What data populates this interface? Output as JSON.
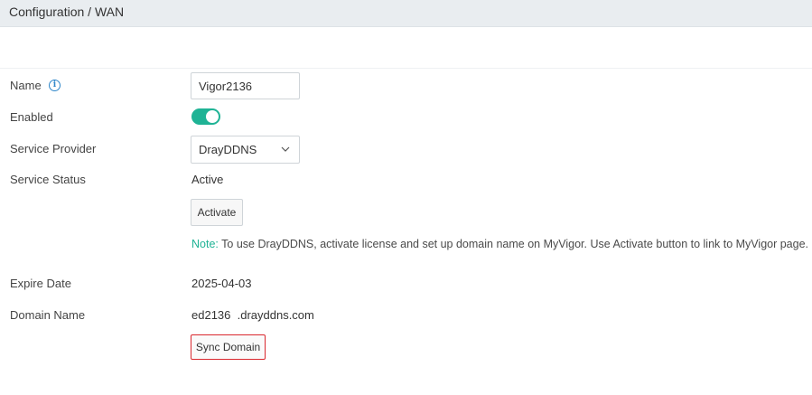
{
  "header": {
    "breadcrumb": "Configuration / WAN"
  },
  "form": {
    "name": {
      "label": "Name",
      "value": "Vigor2136"
    },
    "enabled": {
      "label": "Enabled",
      "on": true
    },
    "service_provider": {
      "label": "Service Provider",
      "selected": "DrayDDNS"
    },
    "service_status": {
      "label": "Service Status",
      "value": "Active",
      "activate_label": "Activate"
    },
    "note": {
      "prefix": "Note:",
      "text": " To use DrayDDNS, activate license and set up domain name on MyVigor. Use Activate button to link to MyVigor page."
    },
    "expire_date": {
      "label": "Expire Date",
      "value": "2025-04-03"
    },
    "domain_name": {
      "label": "Domain Name",
      "value": "ed2136  .drayddns.com",
      "sync_label": "Sync Domain"
    }
  },
  "colors": {
    "accent": "#1fb395",
    "info": "#2f86c9",
    "highlight": "#d9282f"
  },
  "icons": {
    "name_info": "info-icon",
    "provider_dropdown": "chevron-down-icon"
  }
}
